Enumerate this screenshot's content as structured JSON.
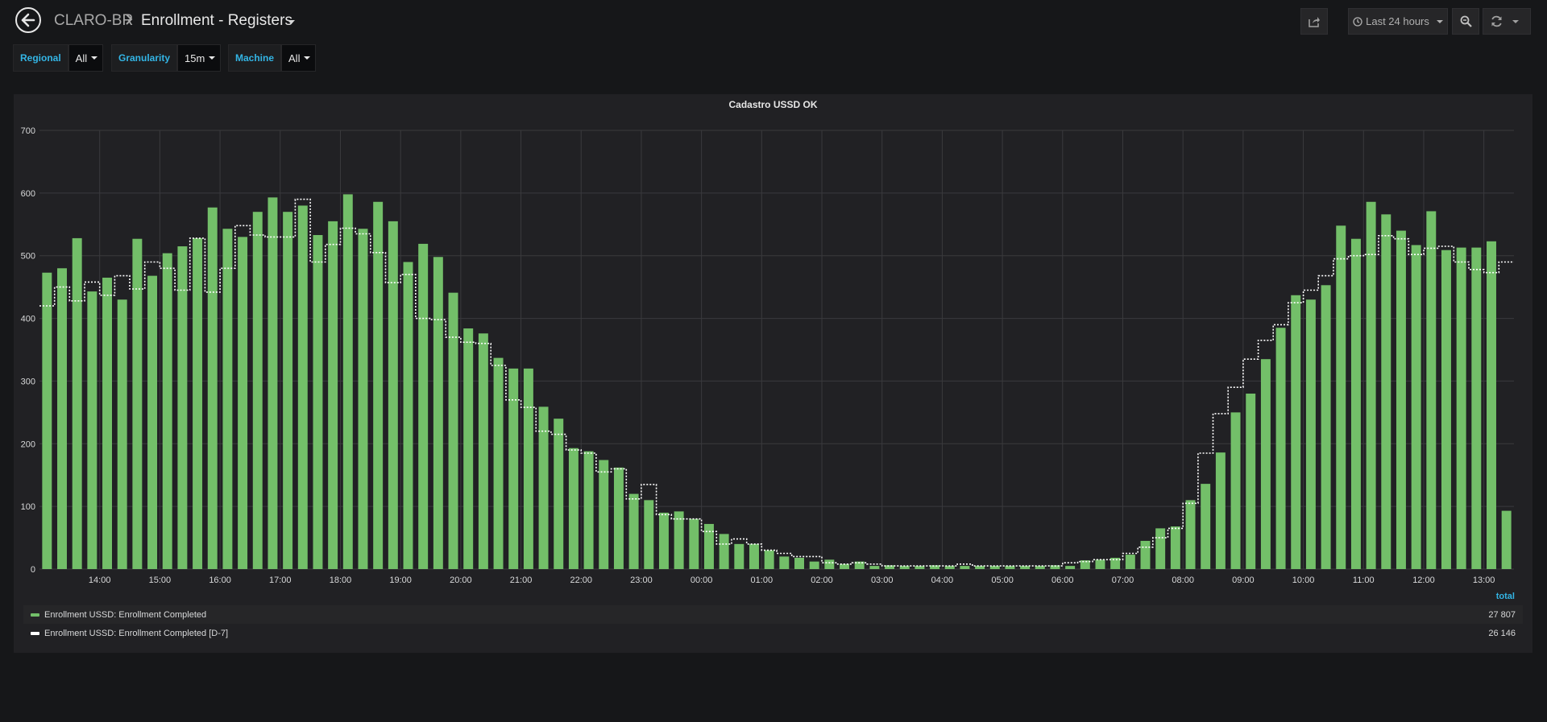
{
  "breadcrumb": {
    "folder": "CLARO-BR",
    "title": "Enrollment - Registers"
  },
  "time_picker": {
    "label": "Last 24 hours"
  },
  "variables": [
    {
      "label": "Regional",
      "value": "All"
    },
    {
      "label": "Granularity",
      "value": "15m"
    },
    {
      "label": "Machine",
      "value": "All"
    }
  ],
  "icons": {
    "back": "arrow-left-circle-icon",
    "share": "share-icon",
    "clock": "clock-icon",
    "zoom": "magnifier-icon",
    "refresh": "refresh-icon"
  },
  "colors": {
    "series_completed": "#73bf69",
    "series_d7": "#ffffff",
    "accent": "#33b5e5",
    "grid": "#3a3a3d"
  },
  "legend": {
    "total_header": "total",
    "items": [
      {
        "name": "Enrollment USSD: Enrollment Completed",
        "value": "27 807"
      },
      {
        "name": "Enrollment USSD: Enrollment Completed [D-7]",
        "value": "26 146"
      }
    ]
  },
  "chart_data": {
    "type": "bar",
    "title": "Cadastro USSD OK",
    "ylim": [
      0,
      700
    ],
    "yticks": [
      "0",
      "100",
      "200",
      "300",
      "400",
      "500",
      "600",
      "700"
    ],
    "xticks": [
      "14:00",
      "15:00",
      "16:00",
      "17:00",
      "18:00",
      "19:00",
      "20:00",
      "21:00",
      "22:00",
      "23:00",
      "00:00",
      "01:00",
      "02:00",
      "03:00",
      "04:00",
      "05:00",
      "06:00",
      "07:00",
      "08:00",
      "09:00",
      "10:00",
      "11:00",
      "12:00",
      "13:00"
    ],
    "grid": true,
    "legend_position": "bottom",
    "x_start": "13:00",
    "x_step_minutes": 15,
    "series": [
      {
        "name": "Enrollment USSD: Enrollment Completed",
        "style": "bars",
        "values": [
          473,
          480,
          528,
          443,
          465,
          430,
          527,
          468,
          504,
          515,
          528,
          577,
          543,
          530,
          570,
          593,
          570,
          580,
          533,
          555,
          598,
          543,
          586,
          555,
          490,
          519,
          498,
          441,
          384,
          376,
          337,
          320,
          320,
          259,
          240,
          193,
          188,
          174,
          162,
          120,
          110,
          90,
          92,
          80,
          72,
          56,
          40,
          40,
          30,
          20,
          18,
          12,
          15,
          8,
          12,
          5,
          6,
          5,
          5,
          6,
          5,
          5,
          5,
          5,
          5,
          5,
          5,
          6,
          5,
          14,
          15,
          18,
          23,
          45,
          65,
          68,
          110,
          136,
          186,
          250,
          280,
          335,
          385,
          437,
          430,
          453,
          548,
          527,
          586,
          566,
          540,
          517,
          571,
          509,
          513,
          513,
          523,
          93
        ]
      },
      {
        "name": "Enrollment USSD: Enrollment Completed [D-7]",
        "style": "dotted-step",
        "values": [
          420,
          450,
          428,
          458,
          437,
          468,
          447,
          490,
          480,
          445,
          528,
          442,
          480,
          548,
          533,
          530,
          530,
          590,
          490,
          518,
          544,
          535,
          505,
          457,
          470,
          400,
          398,
          370,
          362,
          360,
          325,
          270,
          258,
          220,
          215,
          190,
          185,
          155,
          160,
          112,
          135,
          87,
          80,
          80,
          60,
          40,
          48,
          40,
          30,
          25,
          20,
          20,
          10,
          8,
          10,
          8,
          5,
          5,
          5,
          5,
          5,
          8,
          5,
          5,
          5,
          5,
          5,
          5,
          10,
          12,
          15,
          15,
          25,
          35,
          50,
          65,
          105,
          185,
          248,
          290,
          335,
          365,
          390,
          425,
          445,
          468,
          495,
          500,
          502,
          532,
          527,
          502,
          512,
          515,
          490,
          478,
          473,
          490
        ]
      }
    ]
  }
}
